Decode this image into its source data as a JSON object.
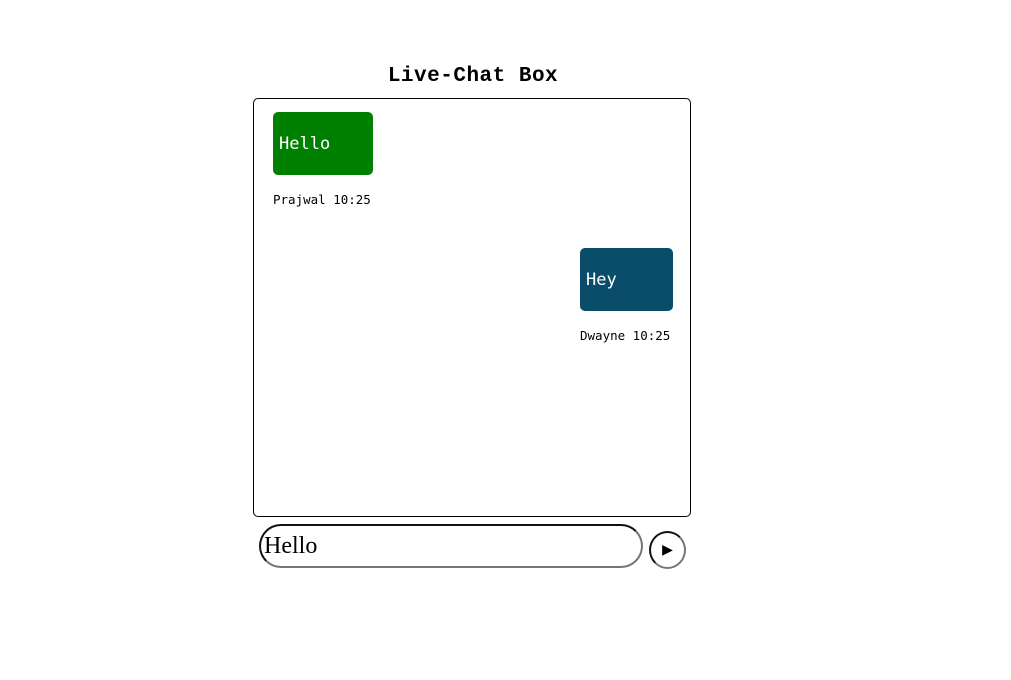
{
  "header": {
    "title": "Live-Chat Box"
  },
  "messages": [
    {
      "text": "Hello",
      "sender": "Prajwal",
      "time": "10:25",
      "meta": "Prajwal 10:25",
      "side": "left",
      "color": "#008000"
    },
    {
      "text": "Hey",
      "sender": "Dwayne",
      "time": "10:25",
      "meta": "Dwayne 10:25",
      "side": "right",
      "color": "#094d6a"
    }
  ],
  "composer": {
    "value": "Hello",
    "send_icon": "play-triangle-icon",
    "send_glyph": "▶"
  }
}
